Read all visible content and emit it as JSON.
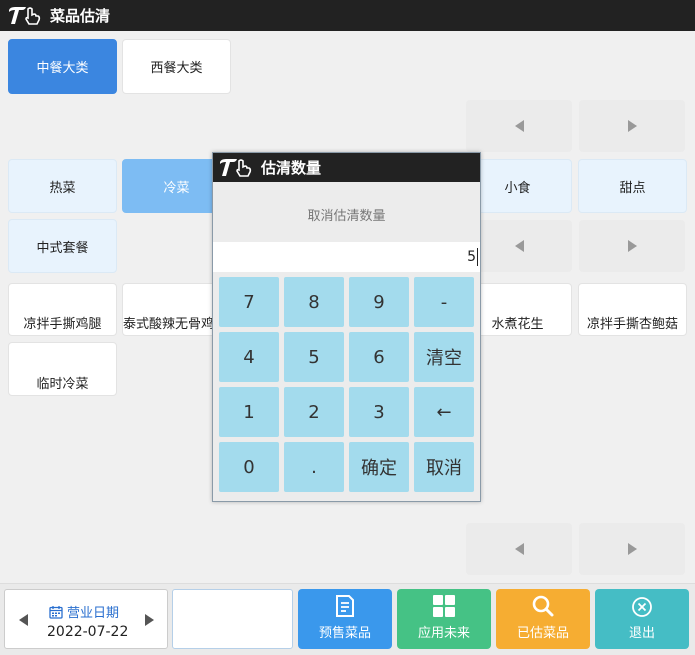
{
  "app": {
    "title": "菜品估清"
  },
  "categories": [
    "中餐大类",
    "西餐大类"
  ],
  "subcategories": {
    "row1": [
      "热菜",
      "冷菜",
      "小食",
      "甜点"
    ],
    "row2": [
      "中式套餐"
    ]
  },
  "dishes": {
    "row1": [
      "凉拌手撕鸡腿",
      "泰式酸辣无骨鸡",
      "水煮花生",
      "凉拌手撕杏鲍菇"
    ],
    "row2": [
      "临时冷菜"
    ]
  },
  "dialog": {
    "title": "估清数量",
    "subtitle": "取消估清数量",
    "input_value": "5",
    "keys": [
      [
        "7",
        "8",
        "9",
        "-"
      ],
      [
        "4",
        "5",
        "6",
        "清空"
      ],
      [
        "1",
        "2",
        "3",
        "←"
      ],
      [
        "0",
        ".",
        "确定",
        "取消"
      ]
    ]
  },
  "footer": {
    "date_label": "营业日期",
    "date_value": "2022-07-22",
    "empty_value": "",
    "buttons": [
      {
        "label": "预售菜品",
        "icon": "document-icon",
        "color": "#3a98ec"
      },
      {
        "label": "应用未来",
        "icon": "grid-icon",
        "color": "#45c285"
      },
      {
        "label": "已估菜品",
        "icon": "search-icon",
        "color": "#f6ad32"
      },
      {
        "label": "退出",
        "icon": "close-circle-icon",
        "color": "#45bdc5"
      }
    ]
  },
  "colors": {
    "titlebar": "#222222",
    "selected": "#3b86e0",
    "keypad": "#a3dbed"
  }
}
